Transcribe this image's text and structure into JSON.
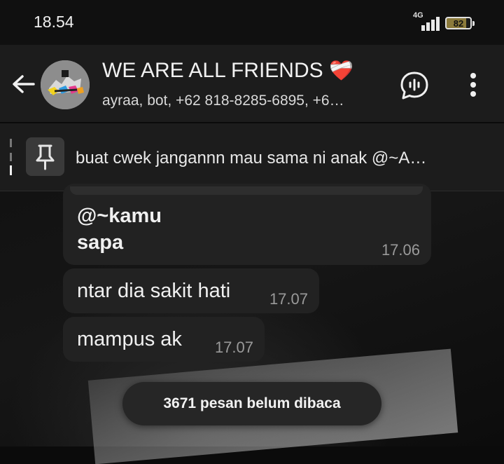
{
  "status_bar": {
    "time": "18.54",
    "network": "4G",
    "battery": "82"
  },
  "header": {
    "title": "WE ARE ALL FRIENDS",
    "title_emoji": "❤️‍🩹",
    "subtitle": "ayraa, bot, +62 818-8285-6895, +6…"
  },
  "pinned": {
    "text": "buat cwek jangannn mau sama ni anak @~A…"
  },
  "messages": [
    {
      "line1": "@~kamu",
      "line2": "sapa",
      "time": "17.06"
    },
    {
      "text": "ntar dia sakit hati",
      "time": "17.07"
    },
    {
      "text": "mampus ak",
      "time": "17.07"
    }
  ],
  "unread_pill": "3671 pesan belum dibaca",
  "icons": {
    "back": "arrow-left-icon",
    "voice_chat": "voice-chat-icon",
    "more": "more-vertical-icon",
    "pin": "pin-icon"
  }
}
